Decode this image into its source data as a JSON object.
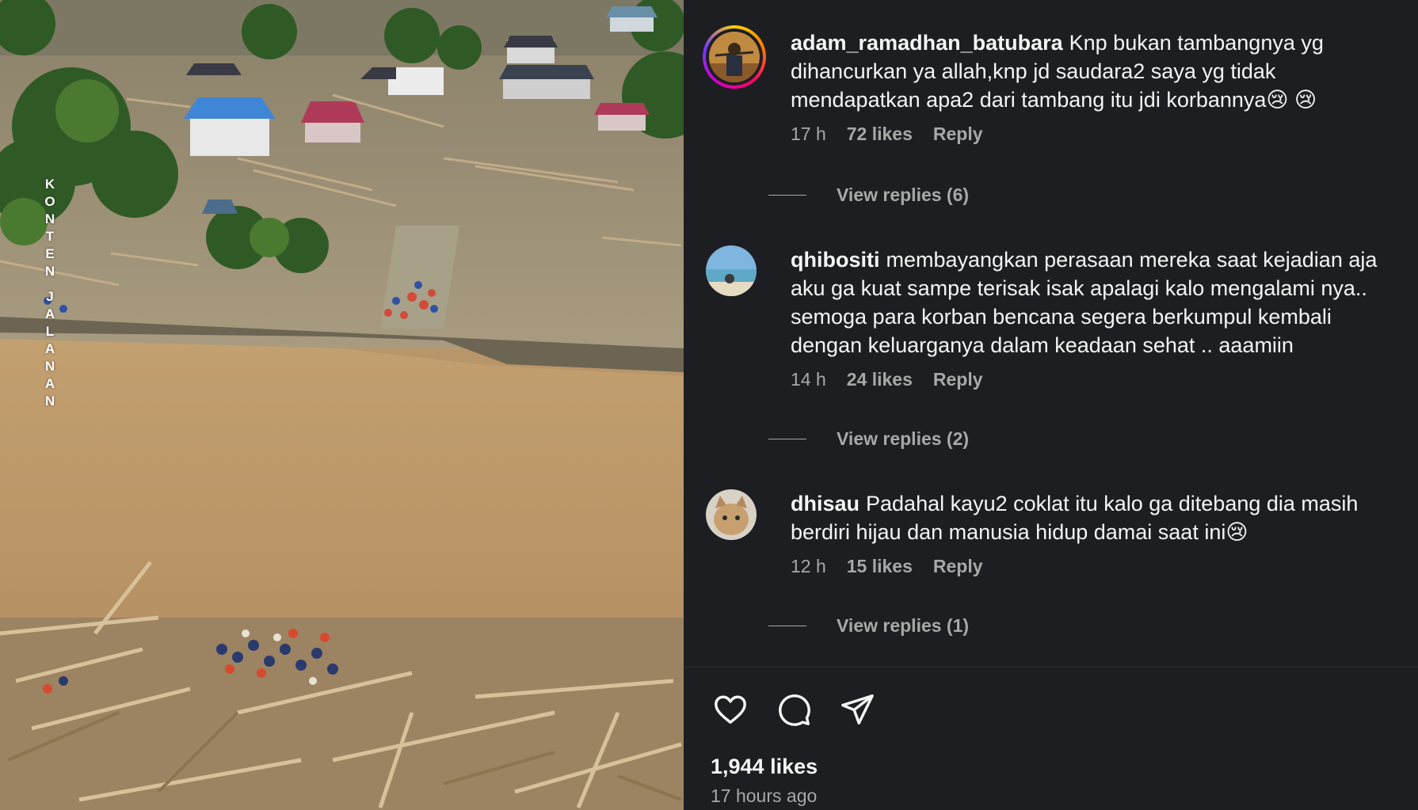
{
  "post": {
    "watermark_letters": [
      "K",
      "O",
      "N",
      "T",
      "E",
      "N",
      "",
      "J",
      "A",
      "L",
      "A",
      "N",
      "A",
      "N"
    ],
    "likes_count": "1,944 likes",
    "posted_ago": "17 hours ago"
  },
  "comments": [
    {
      "username": "adam_ramadhan_batubara",
      "text": "Knp bukan tambangnya yg dihancurkan ya allah,knp jd saudara2 saya yg tidak mendapatkan apa2 dari tambang itu jdi korbannya😢 😢",
      "age": "17 h",
      "likes": "72 likes",
      "reply_label": "Reply",
      "view_replies": "View replies (6)",
      "has_story_ring": true
    },
    {
      "username": "qhibositi",
      "text": "membayangkan perasaan mereka saat kejadian aja aku ga kuat sampe terisak isak apalagi kalo mengalami nya.. semoga para korban bencana segera berkumpul kembali dengan keluarganya dalam keadaan sehat .. aaamiin",
      "age": "14 h",
      "likes": "24 likes",
      "reply_label": "Reply",
      "view_replies": "View replies (2)",
      "has_story_ring": false
    },
    {
      "username": "dhisau",
      "text": "Padahal kayu2 coklat itu kalo ga ditebang dia masih berdiri hijau dan manusia hidup damai saat ini😢",
      "age": "12 h",
      "likes": "15 likes",
      "reply_label": "Reply",
      "view_replies": "View replies (1)",
      "has_story_ring": false
    }
  ],
  "actions": {
    "like_icon": "heart-icon",
    "comment_icon": "comment-bubble-icon",
    "share_icon": "paper-plane-icon"
  },
  "colors": {
    "panel_bg": "#1d1e22",
    "text_primary": "#f5f5f5",
    "text_secondary": "#a8a8a8",
    "flood_water": "#b9966a"
  }
}
